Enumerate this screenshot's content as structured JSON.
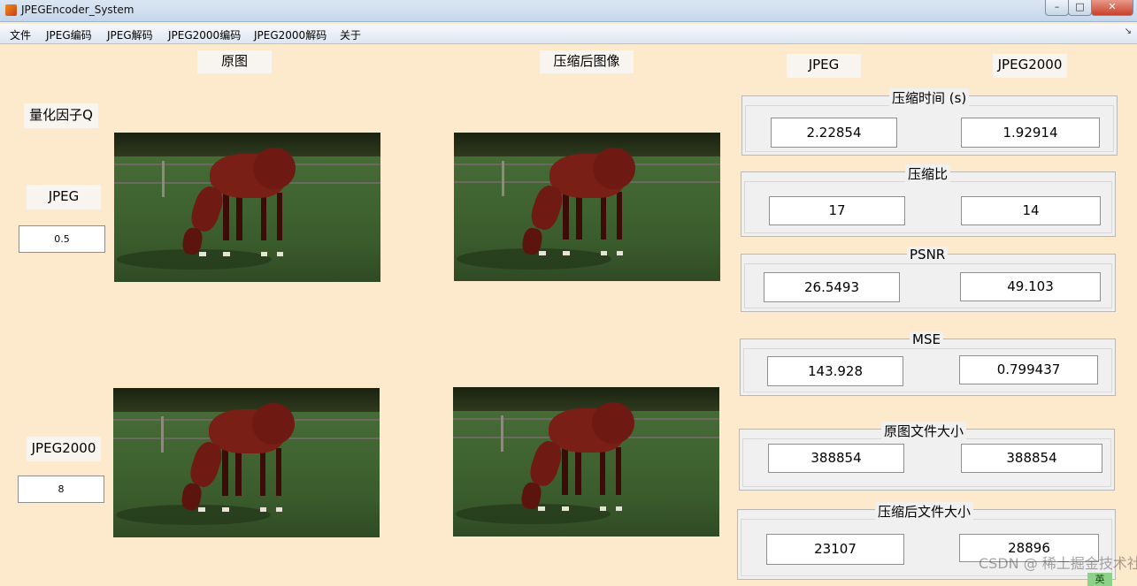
{
  "window": {
    "title": "JPEGEncoder_System",
    "minimize_label": "–",
    "maximize_label": "□",
    "close_label": "✕"
  },
  "menu": {
    "items": [
      "文件",
      "JPEG编码",
      "JPEG解码",
      "JPEG2000编码",
      "JPEG2000解码",
      "关于"
    ],
    "overflow_icon": "↘"
  },
  "headers": {
    "original": "原图",
    "compressed": "压缩后图像",
    "jpeg": "JPEG",
    "jpeg2000": "JPEG2000"
  },
  "quant": {
    "label": "量化因子Q",
    "jpeg_label": "JPEG",
    "jpeg_value": "0.5",
    "jpeg2000_label": "JPEG2000",
    "jpeg2000_value": "8"
  },
  "metrics": [
    {
      "title": "压缩时间 (s)",
      "jpeg": "2.22854",
      "jpeg2000": "1.92914"
    },
    {
      "title": "压缩比",
      "jpeg": "17",
      "jpeg2000": "14"
    },
    {
      "title": "PSNR",
      "jpeg": "26.5493",
      "jpeg2000": "49.103"
    },
    {
      "title": "MSE",
      "jpeg": "143.928",
      "jpeg2000": "0.799437"
    },
    {
      "title": "原图文件大小",
      "jpeg": "388854",
      "jpeg2000": "388854"
    },
    {
      "title": "压缩后文件大小",
      "jpeg": "23107",
      "jpeg2000": "28896"
    }
  ],
  "watermark": "CSDN @ 稀土掘金技术社区",
  "ime_indicator": "英"
}
